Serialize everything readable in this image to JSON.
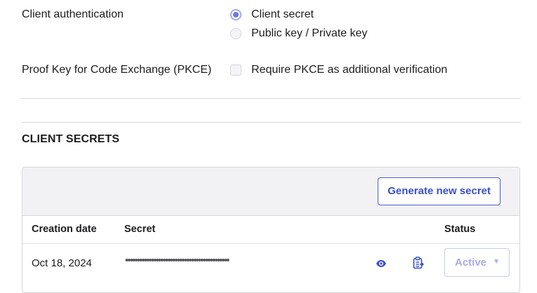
{
  "client_auth": {
    "label": "Client authentication",
    "options": [
      {
        "label": "Client secret",
        "selected": true
      },
      {
        "label": "Public key / Private key",
        "selected": false
      }
    ]
  },
  "pkce": {
    "label": "Proof Key for Code Exchange (PKCE)",
    "checkbox_label": "Require PKCE as additional verification",
    "checked": false
  },
  "client_secrets": {
    "title": "CLIENT SECRETS",
    "generate_button": "Generate new secret",
    "columns": {
      "creation_date": "Creation date",
      "secret": "Secret",
      "status": "Status"
    },
    "rows": [
      {
        "creation_date": "Oct 18, 2024",
        "secret_masked": "••••••••••••••••••••••••••••••••••••••••••••",
        "status": "Active"
      }
    ]
  },
  "colors": {
    "accent": "#4b5fd1",
    "radio_selected": "#6e78e6",
    "status_disabled": "#a5acea"
  },
  "icons": {
    "show_secret": "eye-icon",
    "copy_secret": "clipboard-icon",
    "status_dropdown": "chevron-down-icon"
  }
}
